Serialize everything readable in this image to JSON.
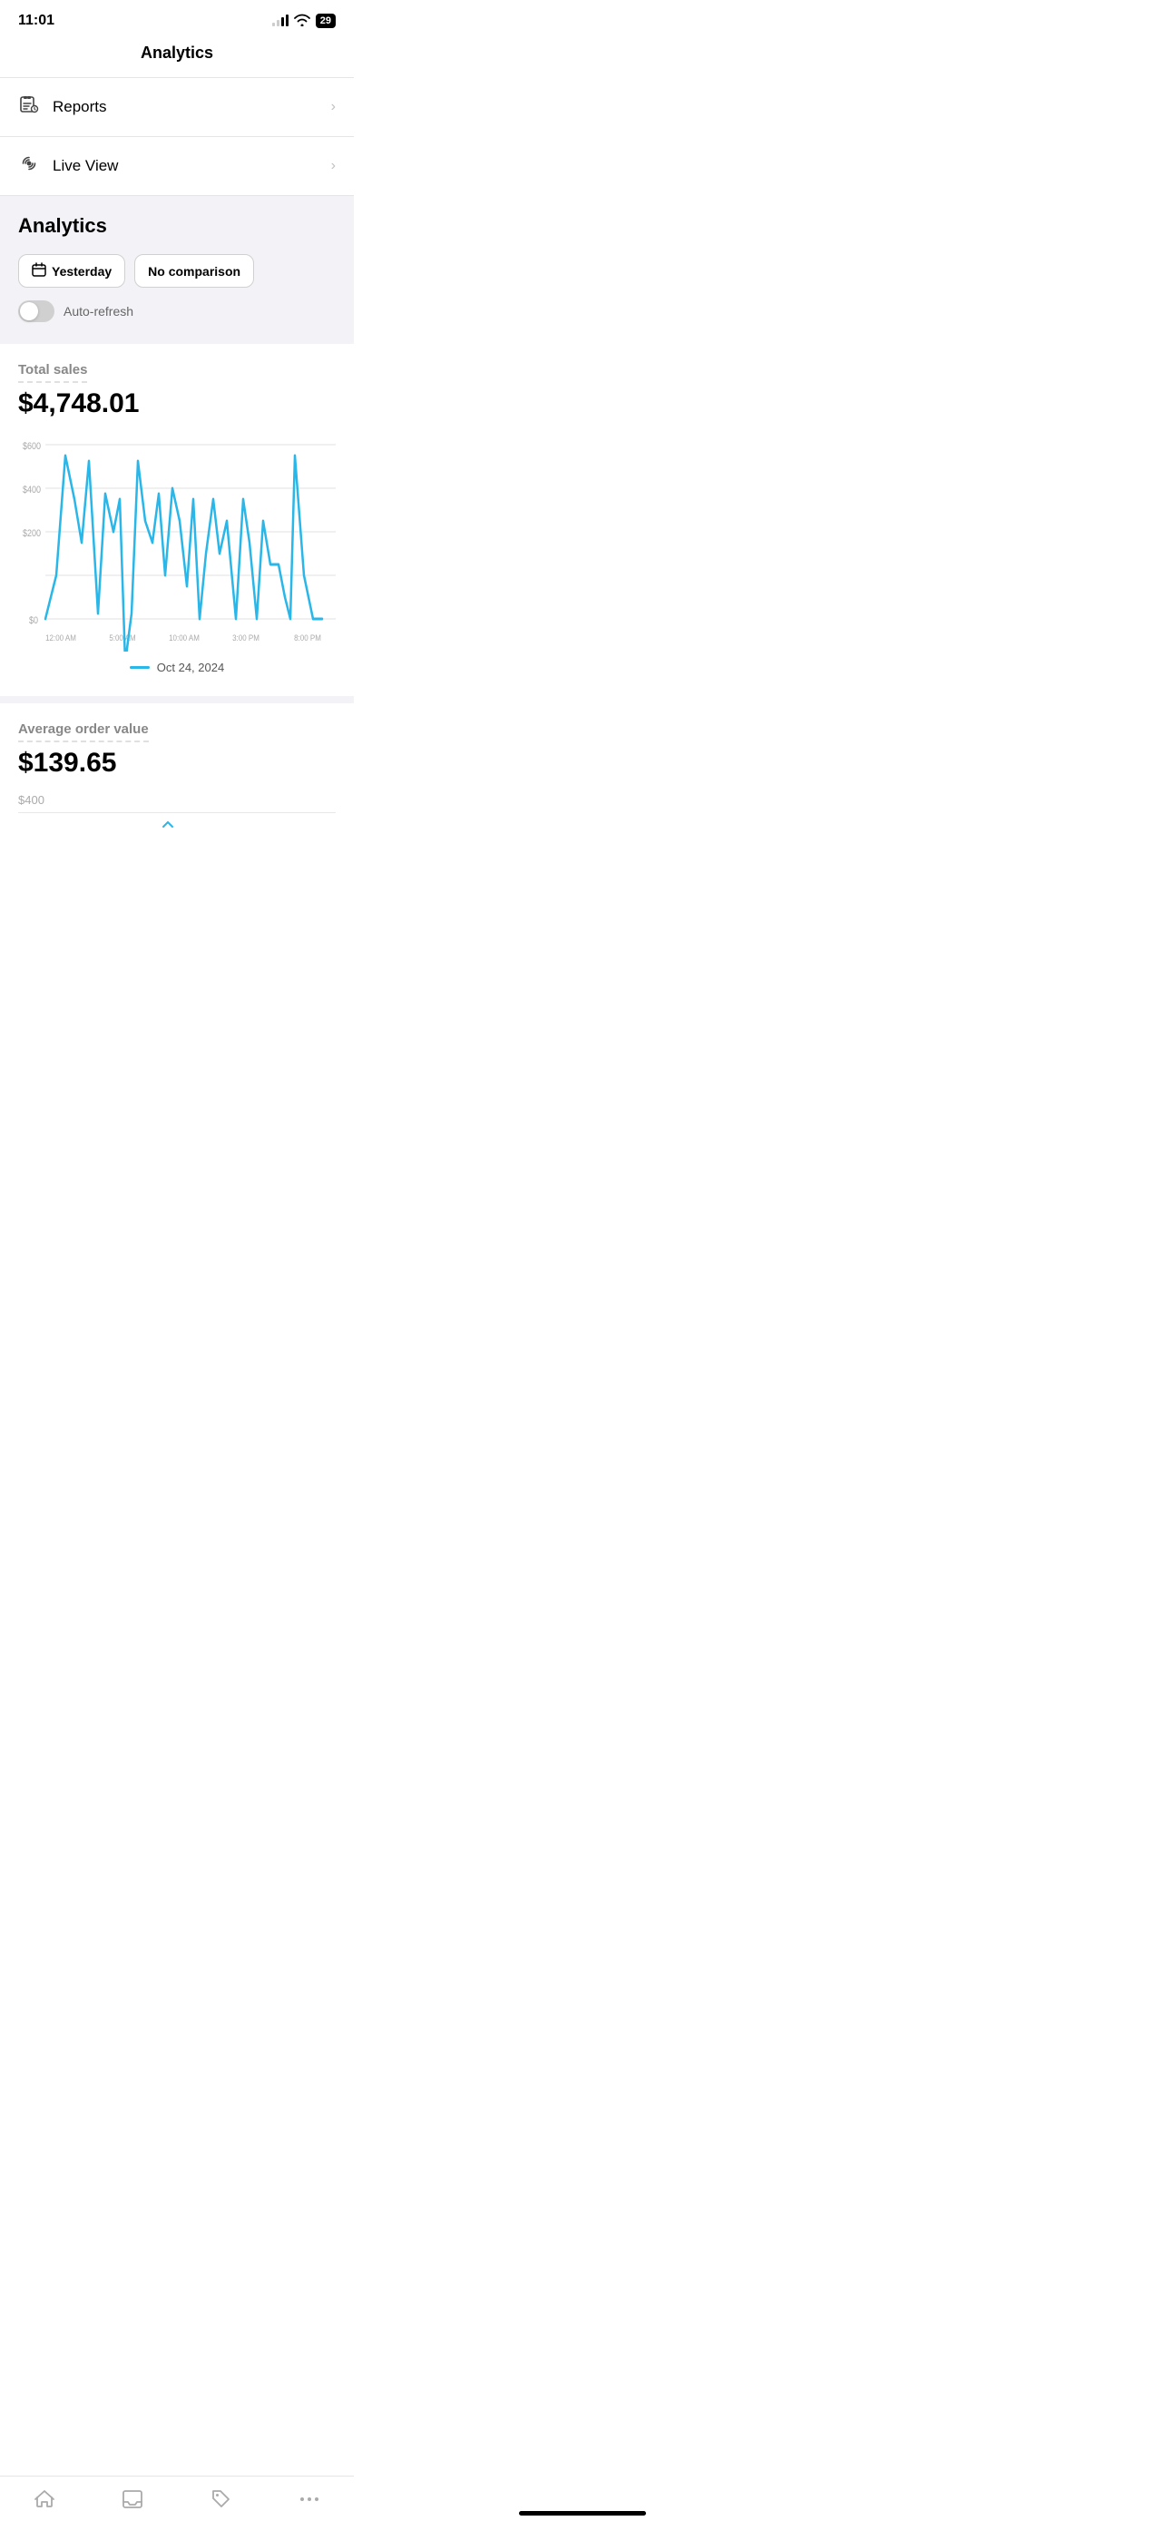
{
  "statusBar": {
    "time": "11:01",
    "battery": "29"
  },
  "header": {
    "title": "Analytics"
  },
  "menuItems": [
    {
      "id": "reports",
      "icon": "📊",
      "label": "Reports",
      "iconType": "reports"
    },
    {
      "id": "liveview",
      "icon": "📡",
      "label": "Live View",
      "iconType": "live"
    }
  ],
  "analyticsSection": {
    "title": "Analytics",
    "dateFilter": "Yesterday",
    "comparisonFilter": "No comparison",
    "autoRefreshLabel": "Auto-refresh"
  },
  "totalSales": {
    "label": "Total sales",
    "value": "$4,748.01",
    "chartLegend": "Oct 24, 2024",
    "yAxis": [
      "$600",
      "$400",
      "$200",
      "$0"
    ],
    "xAxis": [
      "12:00 AM",
      "5:00 AM",
      "10:00 AM",
      "3:00 PM",
      "8:00 PM"
    ]
  },
  "averageOrderValue": {
    "label": "Average order value",
    "value": "$139.65",
    "chartYTop": "$400"
  },
  "bottomNav": [
    {
      "id": "home",
      "icon": "house"
    },
    {
      "id": "inbox",
      "icon": "inbox"
    },
    {
      "id": "tags",
      "icon": "tag"
    },
    {
      "id": "more",
      "icon": "more"
    }
  ]
}
